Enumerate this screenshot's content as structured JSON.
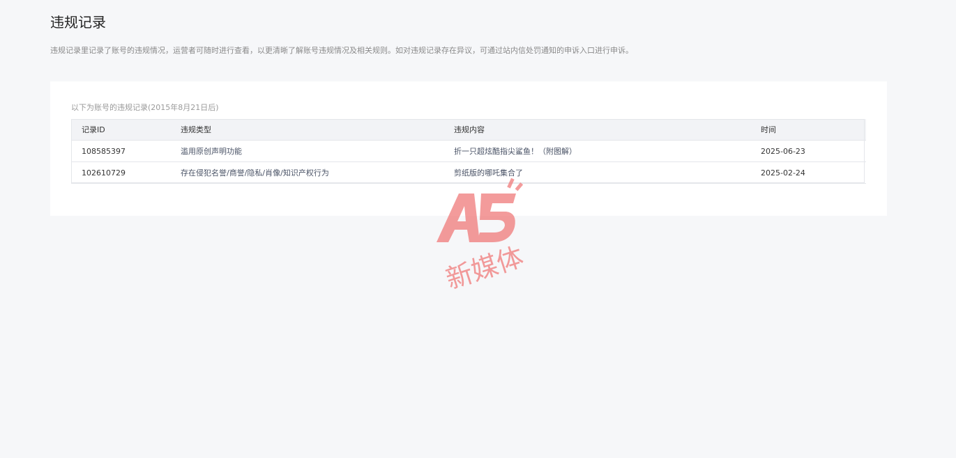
{
  "page": {
    "title": "违规记录",
    "description": "违规记录里记录了账号的违规情况，运营者可随时进行查看，以更清晰了解账号违规情况及相关规则。如对违规记录存在异议，可通过站内信处罚通知的申诉入口进行申诉。"
  },
  "records": {
    "caption": "以下为账号的违规记录(2015年8月21日后)",
    "columns": [
      "记录ID",
      "违规类型",
      "违规内容",
      "时间"
    ],
    "rows": [
      {
        "id": "108585397",
        "type": "滥用原创声明功能",
        "content": "折一只超炫酷指尖鲨鱼！（附图解）",
        "time": "2025-06-23"
      },
      {
        "id": "102610729",
        "type": "存在侵犯名誉/商誉/隐私/肖像/知识产权行为",
        "content": "剪纸版的哪吒集合了",
        "time": "2025-02-24"
      }
    ]
  },
  "watermark": {
    "logo": "A5",
    "text": "新媒体",
    "color": "#f07a7a"
  }
}
